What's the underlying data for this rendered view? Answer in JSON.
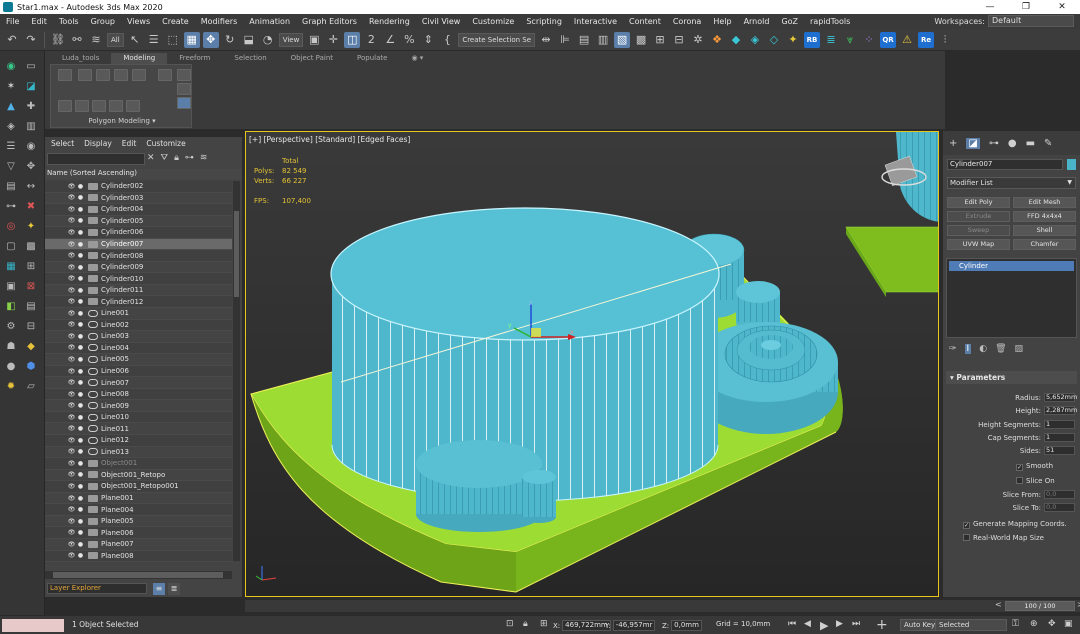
{
  "window": {
    "title": "Star1.max - Autodesk 3ds Max 2020",
    "controls": [
      "—",
      "❐",
      "✕"
    ]
  },
  "menu": [
    "File",
    "Edit",
    "Tools",
    "Group",
    "Views",
    "Create",
    "Modifiers",
    "Animation",
    "Graph Editors",
    "Rendering",
    "Civil View",
    "Customize",
    "Scripting",
    "Interactive",
    "Content",
    "Corona",
    "Help",
    "Arnold",
    "GoZ",
    "rapidTools"
  ],
  "workspace": {
    "label": "Workspaces:",
    "value": "Default"
  },
  "toolbar": {
    "filter": "All",
    "coord_system": "View",
    "selection_set": "Create Selection Se"
  },
  "ribbon": {
    "tabs": [
      "Luda_tools",
      "Modeling",
      "Freeform",
      "Selection",
      "Object Paint",
      "Populate"
    ],
    "active_tab": "Modeling",
    "panel_label": "Polygon Modeling ▾"
  },
  "scene_explorer": {
    "menu": [
      "Select",
      "Display",
      "Edit",
      "Customize"
    ],
    "column": "Name (Sorted Ascending)",
    "rows": [
      {
        "name": "Cylinder002",
        "type": "obj",
        "state": ""
      },
      {
        "name": "Cylinder003",
        "type": "obj",
        "state": ""
      },
      {
        "name": "Cylinder004",
        "type": "obj",
        "state": ""
      },
      {
        "name": "Cylinder005",
        "type": "obj",
        "state": ""
      },
      {
        "name": "Cylinder006",
        "type": "obj",
        "state": ""
      },
      {
        "name": "Cylinder007",
        "type": "obj",
        "state": "sel"
      },
      {
        "name": "Cylinder008",
        "type": "obj",
        "state": ""
      },
      {
        "name": "Cylinder009",
        "type": "obj",
        "state": ""
      },
      {
        "name": "Cylinder010",
        "type": "obj",
        "state": ""
      },
      {
        "name": "Cylinder011",
        "type": "obj",
        "state": ""
      },
      {
        "name": "Cylinder012",
        "type": "obj",
        "state": ""
      },
      {
        "name": "Line001",
        "type": "line",
        "state": ""
      },
      {
        "name": "Line002",
        "type": "line",
        "state": ""
      },
      {
        "name": "Line003",
        "type": "line",
        "state": ""
      },
      {
        "name": "Line004",
        "type": "line",
        "state": ""
      },
      {
        "name": "Line005",
        "type": "line",
        "state": ""
      },
      {
        "name": "Line006",
        "type": "line",
        "state": ""
      },
      {
        "name": "Line007",
        "type": "line",
        "state": ""
      },
      {
        "name": "Line008",
        "type": "line",
        "state": ""
      },
      {
        "name": "Line009",
        "type": "line",
        "state": ""
      },
      {
        "name": "Line010",
        "type": "line",
        "state": ""
      },
      {
        "name": "Line011",
        "type": "line",
        "state": ""
      },
      {
        "name": "Line012",
        "type": "line",
        "state": ""
      },
      {
        "name": "Line013",
        "type": "line",
        "state": ""
      },
      {
        "name": "Object001",
        "type": "obj",
        "state": "dim"
      },
      {
        "name": "Object001_Retopo",
        "type": "obj",
        "state": ""
      },
      {
        "name": "Object001_Retopo001",
        "type": "obj",
        "state": ""
      },
      {
        "name": "Plane001",
        "type": "obj",
        "state": ""
      },
      {
        "name": "Plane004",
        "type": "obj",
        "state": ""
      },
      {
        "name": "Plane005",
        "type": "obj",
        "state": ""
      },
      {
        "name": "Plane006",
        "type": "obj",
        "state": ""
      },
      {
        "name": "Plane007",
        "type": "obj",
        "state": ""
      },
      {
        "name": "Plane008",
        "type": "obj",
        "state": ""
      }
    ],
    "layer_explorer": "Layer Explorer"
  },
  "viewport": {
    "label": "[+] [Perspective] [Standard] [Edged Faces]",
    "stats": {
      "total_label": "Total",
      "polys_label": "Polys:",
      "polys": "82 549",
      "verts_label": "Verts:",
      "verts": "66 227",
      "fps_label": "FPS:",
      "fps": "107,400"
    },
    "gizmo": {
      "z": "z",
      "x": "x",
      "y": "y"
    }
  },
  "command_panel": {
    "object_name": "Cylinder007",
    "object_color": "#4ab5c9",
    "modifier_list": "Modifier List",
    "modifier_buttons": [
      {
        "label": "Edit Poly",
        "enabled": true
      },
      {
        "label": "Edit Mesh",
        "enabled": true
      },
      {
        "label": "Extrude",
        "enabled": false
      },
      {
        "label": "FFD 4x4x4",
        "enabled": true
      },
      {
        "label": "Sweep",
        "enabled": false
      },
      {
        "label": "Shell",
        "enabled": true
      },
      {
        "label": "UVW Map",
        "enabled": true
      },
      {
        "label": "Chamfer",
        "enabled": true
      }
    ],
    "stack_item": "Cylinder",
    "parameters_title": "Parameters",
    "params": [
      {
        "label": "Radius:",
        "value": "5,652mm"
      },
      {
        "label": "Height:",
        "value": "2,287mm"
      },
      {
        "label": "Height Segments:",
        "value": "1"
      },
      {
        "label": "Cap Segments:",
        "value": "1"
      },
      {
        "label": "Sides:",
        "value": "51"
      }
    ],
    "smooth_label": "Smooth",
    "slice_on_label": "Slice On",
    "slice_params": [
      {
        "label": "Slice From:",
        "value": "0,0"
      },
      {
        "label": "Slice To:",
        "value": "0,0"
      }
    ],
    "gen_mapping_label": "Generate Mapping Coords.",
    "real_world_label": "Real-World Map Size"
  },
  "time_slider": {
    "frames": "100 / 100",
    "prev": "<",
    "next": ">"
  },
  "status": {
    "text": "1 Object Selected",
    "x_label": "X:",
    "x": "469,722mm",
    "y_label": "Y:",
    "y": "-46,957mr",
    "z_label": "Z:",
    "z": "0,0mm",
    "grid": "Grid = 10,0mm",
    "auto_key": "Auto Key",
    "key_mode": "Selected"
  },
  "colors": {
    "accent_blue": "#5b7fa9",
    "viewport_border": "#e8c51c",
    "cylinder": "#56c0d4",
    "base": "#8fd12a"
  }
}
